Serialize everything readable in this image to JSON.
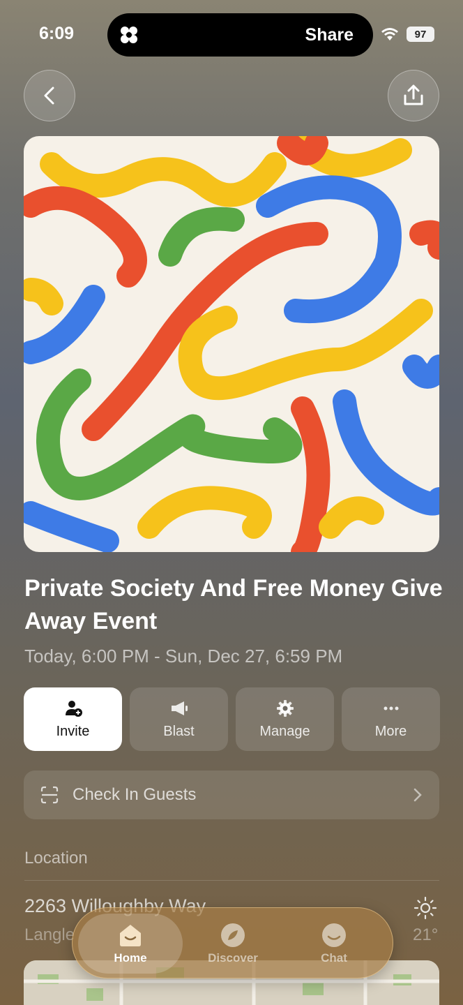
{
  "status": {
    "time": "6:09",
    "island_label": "Share",
    "battery": "97"
  },
  "event": {
    "title": "Private Society And Free Money Give Away Event",
    "datetime": "Today, 6:00 PM - Sun, Dec 27, 6:59 PM"
  },
  "actions": [
    {
      "label": "Invite",
      "icon": "add-person-icon"
    },
    {
      "label": "Blast",
      "icon": "megaphone-icon"
    },
    {
      "label": "Manage",
      "icon": "gear-icon"
    },
    {
      "label": "More",
      "icon": "more-dots-icon"
    }
  ],
  "checkin": {
    "label": "Check In Guests"
  },
  "location": {
    "section_label": "Location",
    "address": "2263 Willoughby Way",
    "city": "Langle",
    "temperature": "21°",
    "weather_icon": "sun-icon"
  },
  "tabs": [
    {
      "label": "Home",
      "active": true
    },
    {
      "label": "Discover",
      "active": false
    },
    {
      "label": "Chat",
      "active": false
    }
  ],
  "colors": {
    "accent_blue": "#3e7be6",
    "accent_red": "#e9502e",
    "accent_yellow": "#f6c21b",
    "accent_green": "#5aa846"
  }
}
